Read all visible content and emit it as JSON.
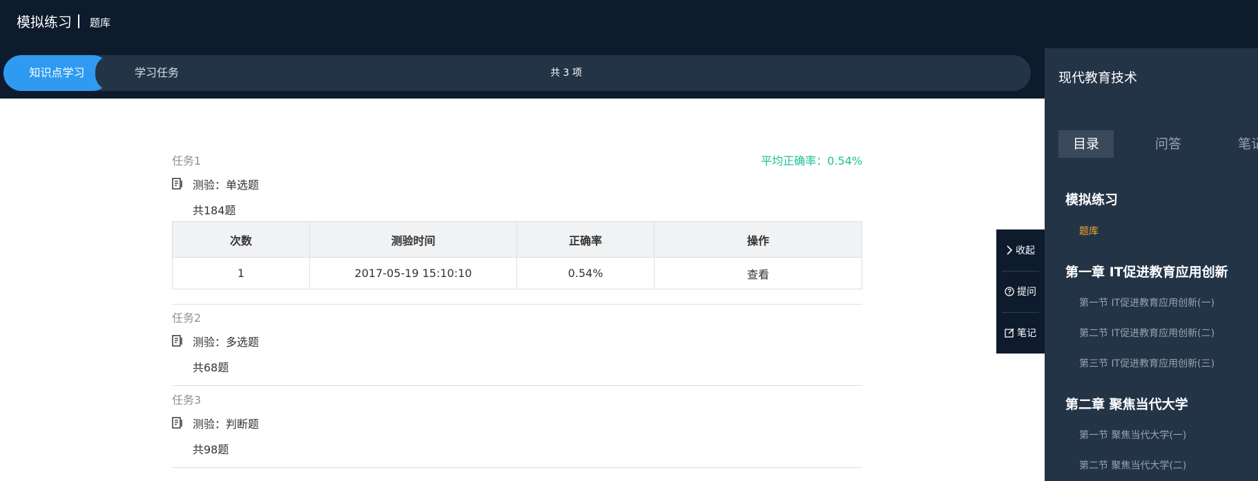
{
  "header": {
    "title": "模拟练习",
    "breadcrumb": "题库"
  },
  "tabs": {
    "active": "知识点学习",
    "second": "学习任务",
    "count": "共 3 项"
  },
  "avg_rate": "平均正确率：0.54%",
  "tasks": [
    {
      "title": "任务1",
      "quiz": "测验：单选题",
      "count": "共184题",
      "table": {
        "headers": [
          "次数",
          "测验时间",
          "正确率",
          "操作"
        ],
        "rows": [
          [
            "1",
            "2017-05-19 15:10:10",
            "0.54%",
            "查看"
          ]
        ]
      }
    },
    {
      "title": "任务2",
      "quiz": "测验：多选题",
      "count": "共68题"
    },
    {
      "title": "任务3",
      "quiz": "测验：判断题",
      "count": "共98题"
    }
  ],
  "float_buttons": {
    "collapse": "收起",
    "ask": "提问",
    "note": "笔记"
  },
  "sidebar": {
    "course_title": "现代教育技术",
    "tabs": [
      "目录",
      "问答",
      "笔记"
    ],
    "sections": [
      {
        "title": "模拟练习",
        "items": [
          "题库"
        ]
      },
      {
        "title": "第一章 IT促进教育应用创新",
        "items": [
          "第一节 IT促进教育应用创新(一)",
          "第二节 IT促进教育应用创新(二)",
          "第三节 IT促进教育应用创新(三)"
        ]
      },
      {
        "title": "第二章 聚焦当代大学",
        "items": [
          "第一节 聚焦当代大学(一)",
          "第二节 聚焦当代大学(二)"
        ]
      }
    ]
  },
  "colors": {
    "header_bg": "#0d1b2d",
    "tab_active": "#2e9bf1",
    "sidebar_bg": "#243447",
    "accent_green": "#1fbf97",
    "accent_red": "#e84a4a",
    "accent_orange": "#f3a52a"
  },
  "icons": [
    "quiz-icon",
    "chevron-right-icon",
    "question-circle-icon",
    "edit-note-icon"
  ]
}
